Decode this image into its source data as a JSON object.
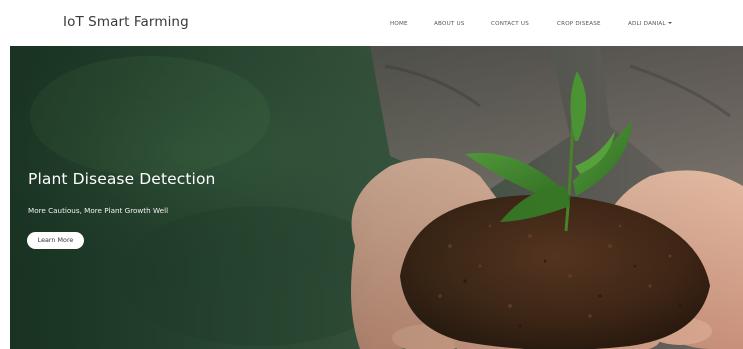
{
  "navbar": {
    "brand": "IoT Smart Farming",
    "links": [
      {
        "label": "HOME"
      },
      {
        "label": "ABOUT US"
      },
      {
        "label": "CONTACT US"
      },
      {
        "label": "CROP DISEASE"
      },
      {
        "label": "ADLI DANIAL",
        "dropdown": true
      }
    ]
  },
  "hero": {
    "title": "Plant Disease Detection",
    "subtitle": "More Cautious, More Plant Growth Well",
    "button_label": "Learn More",
    "image": "hands-holding-soil-with-seedling"
  },
  "colors": {
    "overlay_green": "#2d4a35",
    "soil": "#4a2c1a",
    "leaf": "#3f8a2c",
    "skin": "#d9a58a"
  }
}
